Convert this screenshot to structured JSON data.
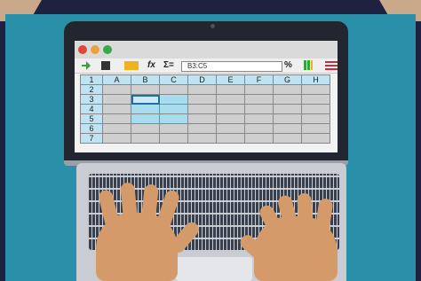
{
  "toolbar": {
    "fx_label": "fx",
    "sigma_label": "Σ=",
    "cell_reference": "B3:C5",
    "percent_label": "%"
  },
  "spreadsheet": {
    "corner_label": "1",
    "columns": [
      "A",
      "B",
      "C",
      "D",
      "E",
      "F",
      "G",
      "H"
    ],
    "rows": [
      "2",
      "3",
      "4",
      "5",
      "6",
      "7"
    ]
  },
  "colors": {
    "background": "#2a8fa8",
    "laptop_frame": "#222631",
    "selection": "#a8dcef",
    "skin": "#d59a6a"
  }
}
